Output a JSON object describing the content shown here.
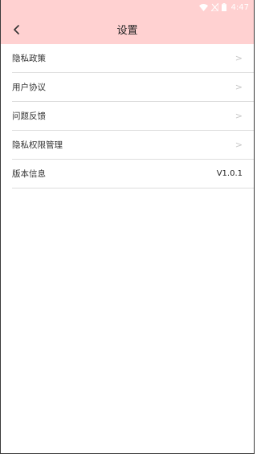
{
  "status_bar": {
    "time": "4:47",
    "icons": [
      "wifi-icon",
      "no-signal-icon",
      "battery-icon"
    ]
  },
  "header": {
    "title": "设置",
    "back_icon": "chevron-left-icon"
  },
  "settings": {
    "items": [
      {
        "label": "隐私政策",
        "arrow": ">"
      },
      {
        "label": "用户协议",
        "arrow": ">"
      },
      {
        "label": "问题反馈",
        "arrow": ">"
      },
      {
        "label": "隐私权限管理",
        "arrow": ">"
      },
      {
        "label": "版本信息",
        "value": "V1.0.1"
      }
    ]
  },
  "colors": {
    "header_bg": "#ffd1d1",
    "divider": "#dddddd",
    "arrow": "#c8c8c8"
  }
}
